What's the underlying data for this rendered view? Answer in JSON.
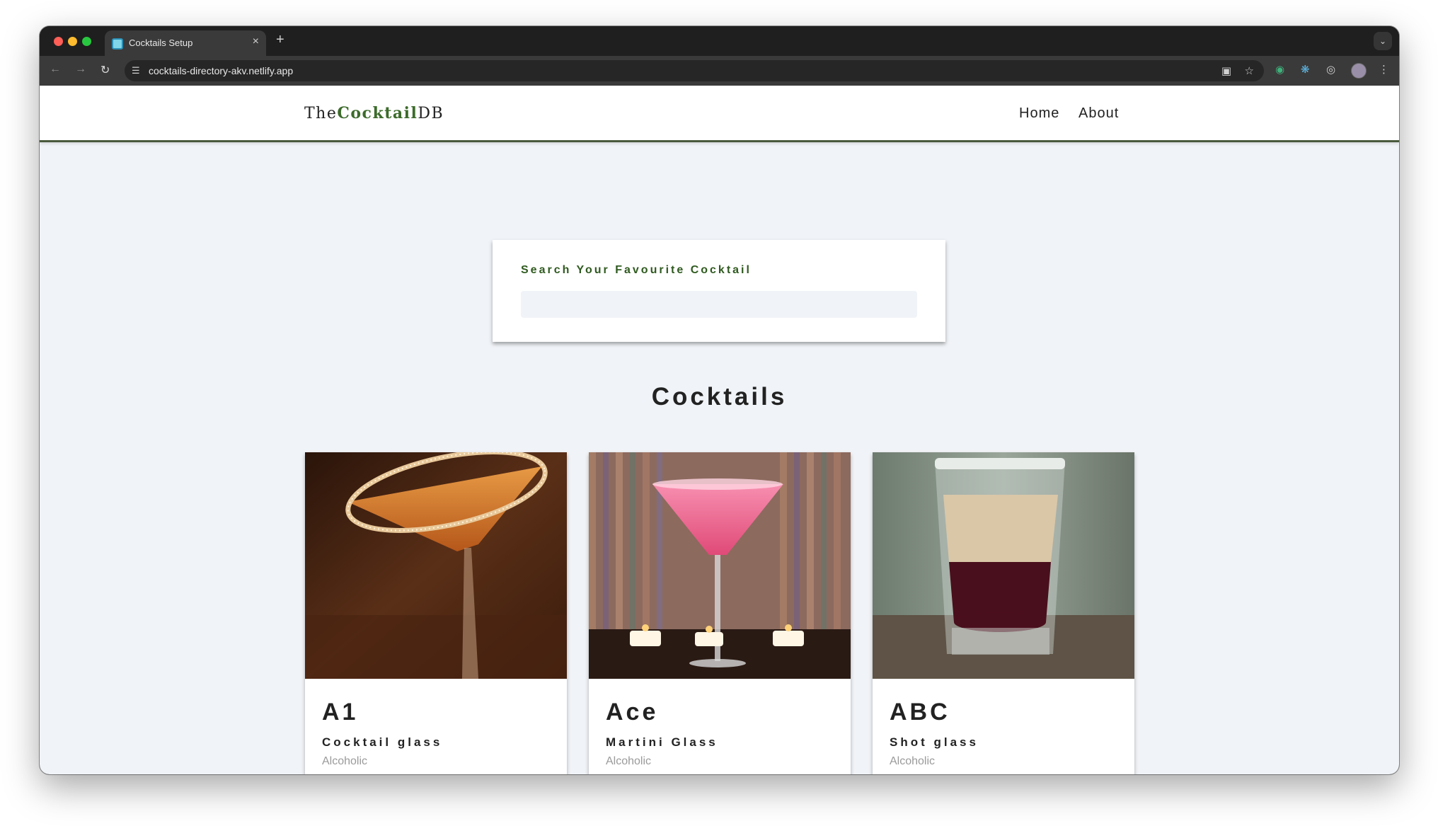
{
  "browser": {
    "tab_title": "Cocktails Setup",
    "tab_close": "×",
    "new_tab": "+",
    "url": "cocktails-directory-akv.netlify.app",
    "icons": [
      "back-icon",
      "forward-icon",
      "reload-icon",
      "site-info-icon",
      "cast-icon",
      "bookmark-star-icon",
      "grammarly-icon",
      "react-devtools-icon",
      "extension-icon",
      "puzzle-icon",
      "profile-avatar",
      "more-menu-icon"
    ]
  },
  "navbar": {
    "logo_prefix": "The",
    "logo_mid": "Cocktail",
    "logo_suffix": "DB",
    "links": [
      "Home",
      "About"
    ]
  },
  "search": {
    "label": "Search Your Favourite Cocktail",
    "value": ""
  },
  "section": {
    "title": "Cocktails"
  },
  "cocktails": [
    {
      "name": "A1",
      "glass": "Cocktail glass",
      "info": "Alcoholic"
    },
    {
      "name": "Ace",
      "glass": "Martini Glass",
      "info": "Alcoholic"
    },
    {
      "name": "ABC",
      "glass": "Shot glass",
      "info": "Alcoholic"
    }
  ],
  "colors": {
    "accent": "#3c6b2b",
    "page_bg": "#f0f3f7",
    "navbar_border": "#4a5a3e",
    "muted_text": "#9a9a9a"
  }
}
